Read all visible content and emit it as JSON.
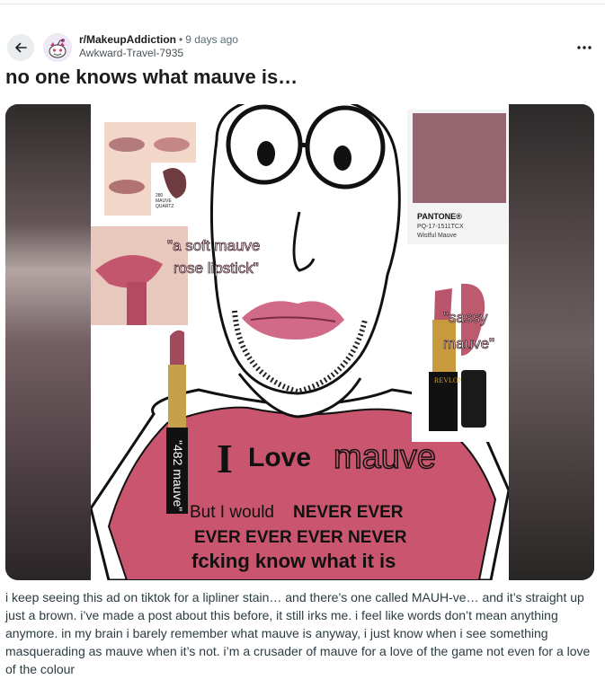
{
  "header": {
    "subreddit": "r/MakeupAddiction",
    "separator": "•",
    "time": "9 days ago",
    "username": "Awkward-Travel-7935"
  },
  "post": {
    "title": "no one knows what mauve is…",
    "body": "i keep seeing this ad on tiktok for a lipliner stain… and there’s one called MAUH-ve… and it’s straight up just a brown. i’ve made a post about this before, it still irks me. i feel like words don’t mean anything anymore. in my brain i barely remember what mauve is anyway, i just know when i see something masquerading as mauve when it’s not. i’m a crusader of mauve for a love of the game not even for a love of the colour"
  },
  "image": {
    "swatch_label": "280\nMAUVE\nQUARTZ",
    "swatch_num": "280",
    "swatch_name1": "MAUVE",
    "swatch_name2": "QUARTZ",
    "pantone_brand": "PANTONE®",
    "pantone_code": "PQ-17-1511TCX",
    "pantone_name": "Wistful Mauve",
    "quote_line1": "\"a soft mauve",
    "quote_line2": "rose lipstick\"",
    "sassy_line1": "\"sassy",
    "sassy_line2": "mauve\"",
    "brand": "REVLON",
    "lipstick_label": "\"482 mauve\"",
    "shirt_i": "I",
    "shirt_love": "Love",
    "shirt_mauve": "mauve",
    "shirt_line2a": "But I would",
    "shirt_line2b": "NEVER EVER",
    "shirt_line3": "EVER EVER EVER NEVER",
    "shirt_line4": "fcking know what it is"
  },
  "colors": {
    "mauve_swatch": "#946670",
    "shirt": "#c9566e",
    "lips": "#d06a88"
  }
}
